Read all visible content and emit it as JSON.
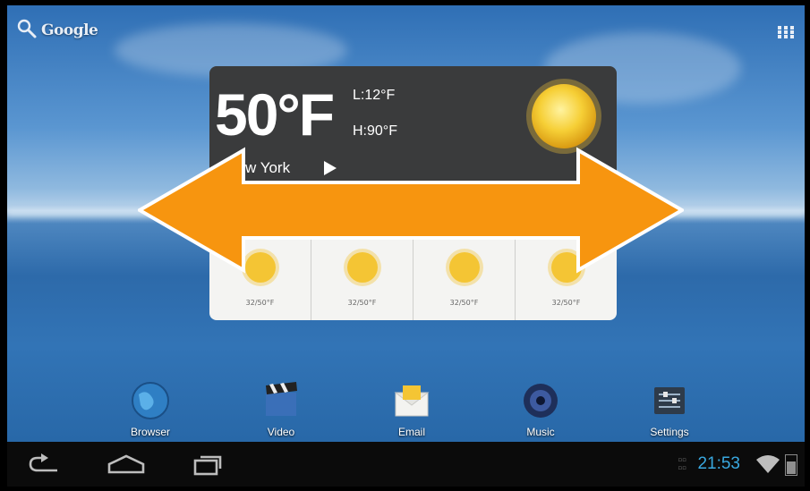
{
  "search": {
    "label": "Google"
  },
  "weather": {
    "temperature": "50°F",
    "low": "L:12°F",
    "high": "H:90°F",
    "city": "w York",
    "forecast": [
      {
        "temp": "32/50°F"
      },
      {
        "temp": "32/50°F"
      },
      {
        "temp": "32/50°F"
      },
      {
        "temp": "32/50°F"
      }
    ]
  },
  "dock": {
    "items": [
      {
        "label": "Browser",
        "icon": "globe-icon"
      },
      {
        "label": "Video",
        "icon": "clapperboard-icon"
      },
      {
        "label": "Email",
        "icon": "envelope-icon"
      },
      {
        "label": "Music",
        "icon": "speaker-icon"
      },
      {
        "label": "Settings",
        "icon": "settings-icon"
      }
    ]
  },
  "status": {
    "time": "21:53"
  },
  "colors": {
    "arrow": "#f7950f",
    "clock": "#39a8e0",
    "widget_dark": "#3a3b3c"
  }
}
